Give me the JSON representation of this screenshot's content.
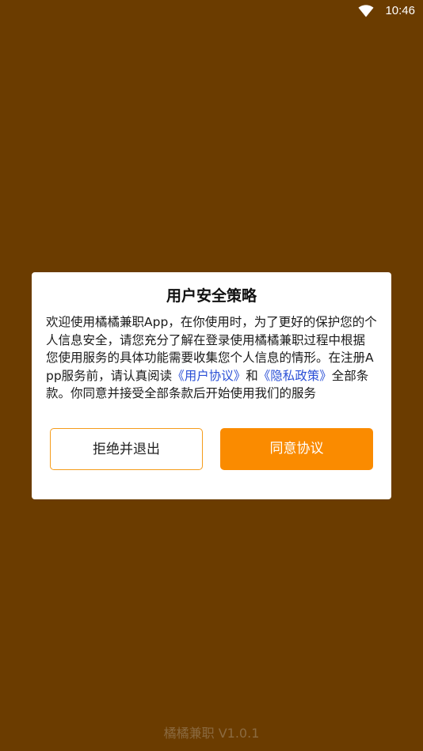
{
  "status_bar": {
    "time": "10:46",
    "wifi_icon": "wifi-icon"
  },
  "dialog": {
    "title": "用户安全策略",
    "body_intro": "欢迎使用橘橘兼职App，在你使用时，为了更好的保护您的个人信息安全，请您充分了解在登录使用橘橘兼职过程中根据您使用服务的具体功能需要收集您个人信息的情形。在注册App服务前，请认真阅读",
    "user_agreement_link": "《用户协议》",
    "and_text": "和",
    "privacy_policy_link": "《隐私政策》",
    "body_outro": "全部条款。你同意并接受全部条款后开始使用我们的服务",
    "reject_button": "拒绝并退出",
    "agree_button": "同意协议"
  },
  "colors": {
    "background": "#6b3c00",
    "accent": "#fa8b00",
    "link": "#2a4fd6"
  },
  "footer": {
    "version": "橘橘兼职 V1.0.1"
  }
}
